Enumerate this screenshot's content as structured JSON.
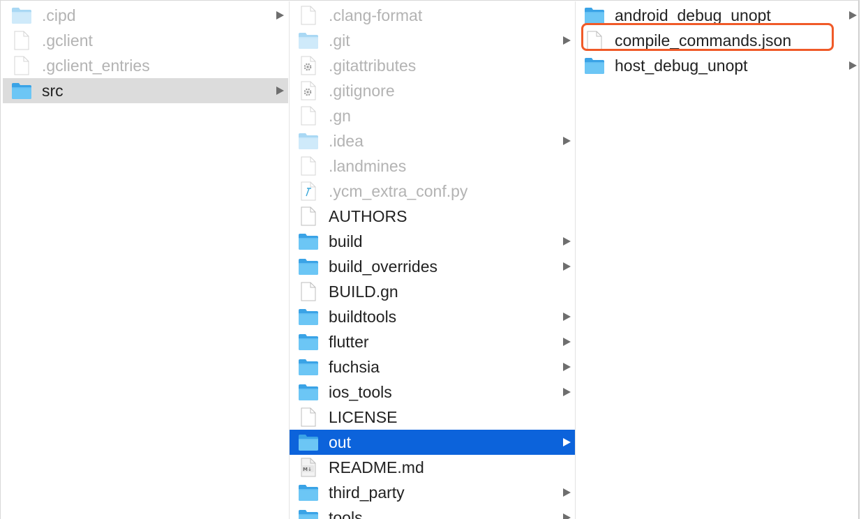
{
  "columns": [
    {
      "items": [
        {
          "label": ".cipd",
          "kind": "folder",
          "dim": true,
          "arrow": true
        },
        {
          "label": ".gclient",
          "kind": "file",
          "dim": true,
          "arrow": false
        },
        {
          "label": ".gclient_entries",
          "kind": "file",
          "dim": true,
          "arrow": false
        },
        {
          "label": "src",
          "kind": "folder",
          "dim": false,
          "arrow": true,
          "selected": "gray"
        }
      ]
    },
    {
      "items": [
        {
          "label": ".clang-format",
          "kind": "file",
          "dim": true,
          "arrow": false
        },
        {
          "label": ".git",
          "kind": "folder",
          "dim": true,
          "arrow": true
        },
        {
          "label": ".gitattributes",
          "kind": "gear",
          "dim": true,
          "arrow": false
        },
        {
          "label": ".gitignore",
          "kind": "gear",
          "dim": true,
          "arrow": false
        },
        {
          "label": ".gn",
          "kind": "file",
          "dim": true,
          "arrow": false
        },
        {
          "label": ".idea",
          "kind": "folder",
          "dim": true,
          "arrow": true
        },
        {
          "label": ".landmines",
          "kind": "file",
          "dim": true,
          "arrow": false
        },
        {
          "label": ".ycm_extra_conf.py",
          "kind": "python",
          "dim": true,
          "arrow": false
        },
        {
          "label": "AUTHORS",
          "kind": "file",
          "dim": false,
          "arrow": false
        },
        {
          "label": "build",
          "kind": "folder",
          "dim": false,
          "arrow": true
        },
        {
          "label": "build_overrides",
          "kind": "folder",
          "dim": false,
          "arrow": true
        },
        {
          "label": "BUILD.gn",
          "kind": "file",
          "dim": false,
          "arrow": false
        },
        {
          "label": "buildtools",
          "kind": "folder",
          "dim": false,
          "arrow": true
        },
        {
          "label": "flutter",
          "kind": "folder",
          "dim": false,
          "arrow": true
        },
        {
          "label": "fuchsia",
          "kind": "folder",
          "dim": false,
          "arrow": true
        },
        {
          "label": "ios_tools",
          "kind": "folder",
          "dim": false,
          "arrow": true
        },
        {
          "label": "LICENSE",
          "kind": "file",
          "dim": false,
          "arrow": false
        },
        {
          "label": "out",
          "kind": "folder",
          "dim": false,
          "arrow": true,
          "selected": "blue"
        },
        {
          "label": "README.md",
          "kind": "markdown",
          "dim": false,
          "arrow": false
        },
        {
          "label": "third_party",
          "kind": "folder",
          "dim": false,
          "arrow": true
        },
        {
          "label": "tools",
          "kind": "folder",
          "dim": false,
          "arrow": true
        }
      ]
    },
    {
      "items": [
        {
          "label": "android_debug_unopt",
          "kind": "folder",
          "dim": false,
          "arrow": true
        },
        {
          "label": "compile_commands.json",
          "kind": "file",
          "dim": false,
          "arrow": false,
          "highlighted": true
        },
        {
          "label": "host_debug_unopt",
          "kind": "folder",
          "dim": false,
          "arrow": true
        }
      ]
    }
  ],
  "colors": {
    "selection_blue": "#0c63db",
    "selection_gray": "#dcdcdc",
    "folder_blue": "#5ab8f0",
    "highlight_orange": "#f05a28"
  }
}
